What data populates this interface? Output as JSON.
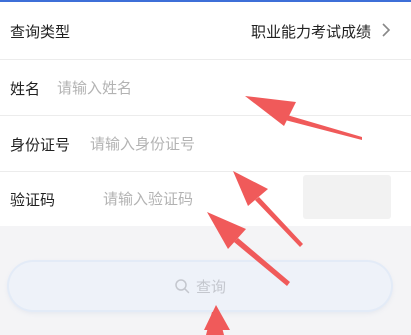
{
  "form": {
    "query_type": {
      "label": "查询类型",
      "value": "职业能力考试成绩"
    },
    "name": {
      "label": "姓名",
      "placeholder": "请输入姓名"
    },
    "id_number": {
      "label": "身份证号",
      "placeholder": "请输入身份证号"
    },
    "captcha": {
      "label": "验证码",
      "placeholder": "请输入验证码"
    }
  },
  "query_button": {
    "label": "查询"
  },
  "colors": {
    "accent": "#3d6fd8",
    "annotation_arrow": "#f05a5a",
    "button_bg": "#eef2f9"
  },
  "icons": [
    "chevron-right-icon",
    "search-icon"
  ]
}
